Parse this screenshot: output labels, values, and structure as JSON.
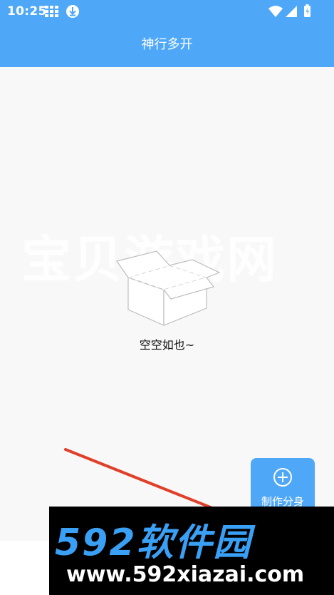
{
  "status_bar": {
    "time": "10:25",
    "icons_left": [
      "grid-icon",
      "download-icon"
    ],
    "icons_right": [
      "wifi-icon",
      "signal-icon",
      "battery-icon"
    ]
  },
  "app_bar": {
    "title": "神行多开"
  },
  "empty_state": {
    "icon": "empty-box-icon",
    "text": "空空如也~"
  },
  "fab": {
    "icon": "plus-circle-icon",
    "label": "制作分身"
  },
  "watermarks": {
    "top_text": "宝贝游戏网",
    "bottom_brand": "592软件园",
    "bottom_url": "www.592xiazai.com"
  },
  "colors": {
    "primary": "#4fa8f7",
    "background": "#f8f8f8",
    "arrow": "#e0402a"
  }
}
